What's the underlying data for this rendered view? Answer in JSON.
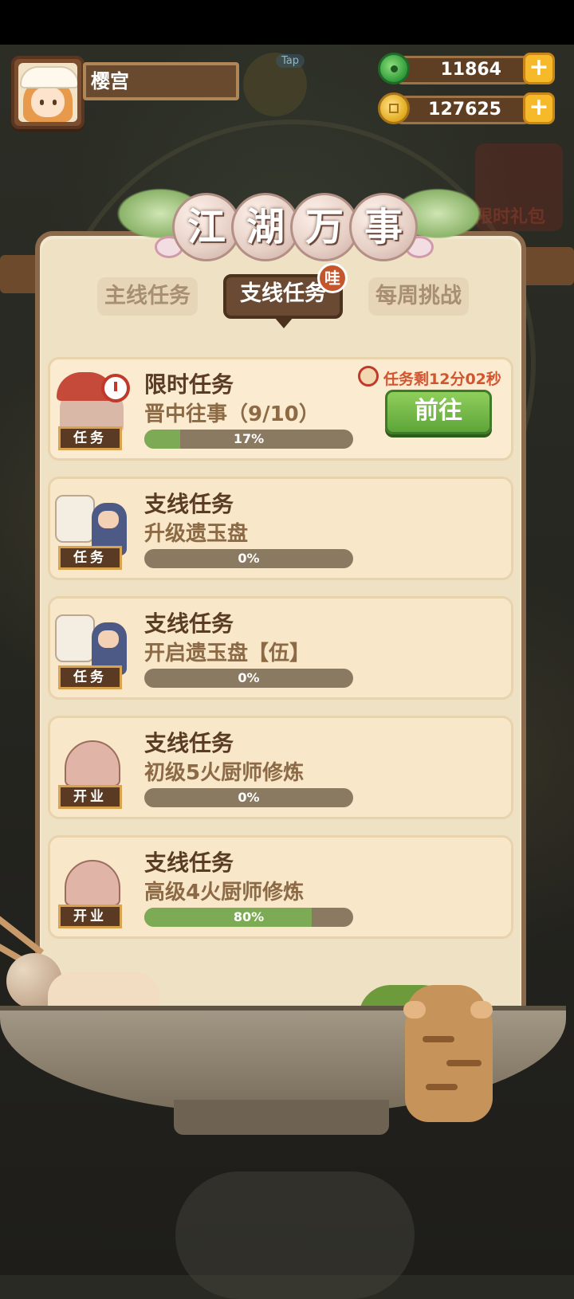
{
  "player": {
    "name": "樱宫"
  },
  "overlay": {
    "tap_badge": "Tap"
  },
  "resources": {
    "jade": {
      "value": "11864",
      "icon": "jade-icon"
    },
    "coins": {
      "value": "127625",
      "icon": "coin-icon"
    },
    "plus_label": "+"
  },
  "side_promo": {
    "label": "限时礼包"
  },
  "panel": {
    "title_chars": [
      "江",
      "湖",
      "万",
      "事"
    ],
    "tabs": [
      {
        "label": "主线任务",
        "active": false
      },
      {
        "label": "支线任务",
        "active": true
      },
      {
        "label": "每周挑战",
        "active": false
      }
    ],
    "badge": "哇"
  },
  "tasks": [
    {
      "type_label": "限时任务",
      "name": "晋中往事（9/10）",
      "progress": 0.17,
      "progress_text": "17%",
      "icon_label": "任务",
      "timer": "任务剩12分02秒",
      "action": "前往"
    },
    {
      "type_label": "支线任务",
      "name": "升级遗玉盘",
      "progress": 0,
      "progress_text": "0%",
      "icon_label": "任务"
    },
    {
      "type_label": "支线任务",
      "name": "开启遗玉盘【伍】",
      "progress": 0,
      "progress_text": "0%",
      "icon_label": "任务"
    },
    {
      "type_label": "支线任务",
      "name": "初级5火厨师修炼",
      "progress": 0,
      "progress_text": "0%",
      "icon_label": "开业"
    },
    {
      "type_label": "支线任务",
      "name": "高级4火厨师修炼",
      "progress": 0.8,
      "progress_text": "80%",
      "icon_label": "开业"
    }
  ],
  "colors": {
    "progress_fill": "#7daa54",
    "progress_track": "#8a7a62",
    "go_button": "#6fb443",
    "timer_text": "#d2552f"
  }
}
